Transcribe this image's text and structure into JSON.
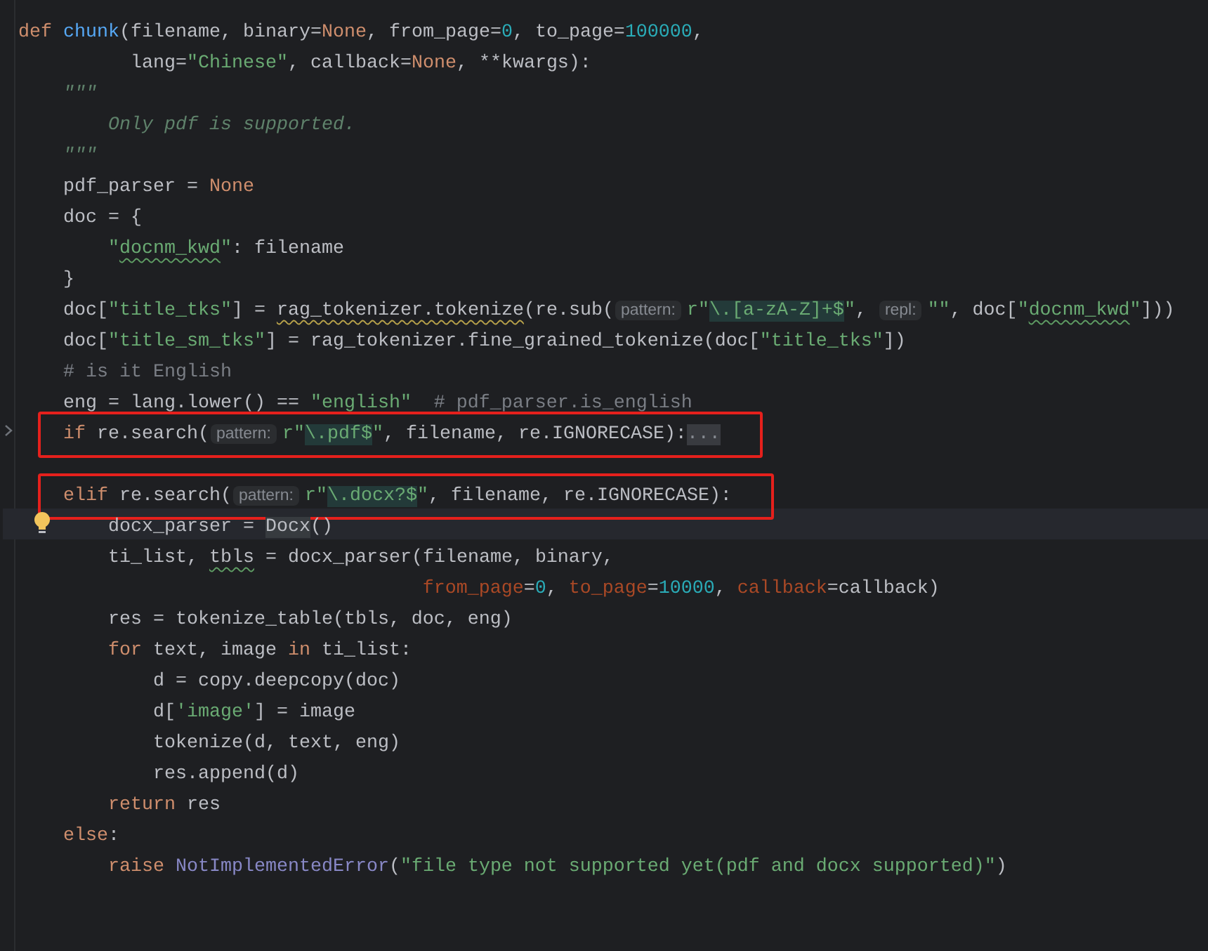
{
  "editor": {
    "lines": [
      {
        "boxed": false,
        "current": false,
        "tokens": [
          {
            "kind": "keyword",
            "text": "def "
          },
          {
            "kind": "function",
            "text": "chunk"
          },
          {
            "kind": "plain",
            "text": "(filename, binary="
          },
          {
            "kind": "keyword",
            "text": "None"
          },
          {
            "kind": "plain",
            "text": ", from_page="
          },
          {
            "kind": "number",
            "text": "0"
          },
          {
            "kind": "plain",
            "text": ", to_page="
          },
          {
            "kind": "number",
            "text": "100000"
          },
          {
            "kind": "plain",
            "text": ","
          }
        ]
      },
      {
        "boxed": false,
        "current": false,
        "tokens": [
          {
            "kind": "plain",
            "text": "          lang="
          },
          {
            "kind": "string",
            "text": "\"Chinese\""
          },
          {
            "kind": "plain",
            "text": ", callback="
          },
          {
            "kind": "keyword",
            "text": "None"
          },
          {
            "kind": "plain",
            "text": ", **kwargs):"
          }
        ]
      },
      {
        "boxed": false,
        "current": false,
        "tokens": [
          {
            "kind": "docstring",
            "text": "    \"\"\""
          }
        ]
      },
      {
        "boxed": false,
        "current": false,
        "tokens": [
          {
            "kind": "docstring",
            "text": "        Only pdf is supported."
          }
        ]
      },
      {
        "boxed": false,
        "current": false,
        "tokens": [
          {
            "kind": "docstring",
            "text": "    \"\"\""
          }
        ]
      },
      {
        "boxed": false,
        "current": false,
        "tokens": [
          {
            "kind": "plain",
            "text": "    pdf_parser = "
          },
          {
            "kind": "keyword",
            "text": "None"
          }
        ]
      },
      {
        "boxed": false,
        "current": false,
        "tokens": [
          {
            "kind": "plain",
            "text": "    doc = {"
          }
        ]
      },
      {
        "boxed": false,
        "current": false,
        "tokens": [
          {
            "kind": "string",
            "text": "        \""
          },
          {
            "kind": "misspelledstring",
            "text": "docnm_kwd"
          },
          {
            "kind": "string",
            "text": "\""
          },
          {
            "kind": "plain",
            "text": ": filename"
          }
        ]
      },
      {
        "boxed": false,
        "current": false,
        "tokens": [
          {
            "kind": "plain",
            "text": "    }"
          }
        ]
      },
      {
        "boxed": false,
        "current": false,
        "tokens": [
          {
            "kind": "plain",
            "text": "    doc["
          },
          {
            "kind": "string",
            "text": "\"title_tks\""
          },
          {
            "kind": "plain",
            "text": "] = "
          },
          {
            "kind": "warned",
            "text": "rag_tokenizer.tokenize"
          },
          {
            "kind": "plain",
            "text": "(re.sub("
          },
          {
            "kind": "hint",
            "text": "pattern:"
          },
          {
            "kind": "string",
            "text": "r\""
          },
          {
            "kind": "regex",
            "text": "\\.[a-zA-Z]+$"
          },
          {
            "kind": "string",
            "text": "\""
          },
          {
            "kind": "plain",
            "text": ", "
          },
          {
            "kind": "hint",
            "text": "repl:"
          },
          {
            "kind": "string",
            "text": "\"\""
          },
          {
            "kind": "plain",
            "text": ", doc["
          },
          {
            "kind": "string",
            "text": "\""
          },
          {
            "kind": "misspelledstring",
            "text": "docnm_kwd"
          },
          {
            "kind": "string",
            "text": "\""
          },
          {
            "kind": "plain",
            "text": "]))"
          }
        ]
      },
      {
        "boxed": false,
        "current": false,
        "tokens": [
          {
            "kind": "plain",
            "text": "    doc["
          },
          {
            "kind": "string",
            "text": "\"title_sm_tks\""
          },
          {
            "kind": "plain",
            "text": "] = rag_tokenizer.fine_grained_tokenize(doc["
          },
          {
            "kind": "string",
            "text": "\"title_tks\""
          },
          {
            "kind": "plain",
            "text": "])"
          }
        ]
      },
      {
        "boxed": false,
        "current": false,
        "tokens": [
          {
            "kind": "comment",
            "text": "    # is it English"
          }
        ]
      },
      {
        "boxed": false,
        "current": false,
        "tokens": [
          {
            "kind": "plain",
            "text": "    eng = lang.lower() == "
          },
          {
            "kind": "string",
            "text": "\"english\""
          },
          {
            "kind": "comment",
            "text": "  # pdf_parser.is_english"
          }
        ]
      },
      {
        "boxed": true,
        "current": false,
        "gutter": {
          "kind": "chevron"
        },
        "tokens": [
          {
            "kind": "keyword",
            "text": "    if"
          },
          {
            "kind": "plain",
            "text": " re.search("
          },
          {
            "kind": "hint",
            "text": "pattern:"
          },
          {
            "kind": "string",
            "text": "r\""
          },
          {
            "kind": "regex",
            "text": "\\.pdf$"
          },
          {
            "kind": "string",
            "text": "\""
          },
          {
            "kind": "plain",
            "text": ", filename, re.IGNORECASE):"
          },
          {
            "kind": "fold",
            "text": "..."
          }
        ]
      },
      {
        "boxed": false,
        "current": false
      },
      {
        "boxed": true,
        "current": false,
        "tokens": [
          {
            "kind": "keyword",
            "text": "    elif"
          },
          {
            "kind": "plain",
            "text": " re.search("
          },
          {
            "kind": "hint",
            "text": "pattern:"
          },
          {
            "kind": "string",
            "text": "r\""
          },
          {
            "kind": "regex",
            "text": "\\.docx?$"
          },
          {
            "kind": "string",
            "text": "\""
          },
          {
            "kind": "plain",
            "text": ", filename, re.IGNORECASE):"
          }
        ]
      },
      {
        "boxed": false,
        "current": true,
        "gutter": {
          "kind": "bulb"
        },
        "tokens": [
          {
            "kind": "plain",
            "text": "        docx_parser = "
          },
          {
            "kind": "marked",
            "text": "Docx"
          },
          {
            "kind": "plain",
            "text": "()"
          }
        ]
      },
      {
        "boxed": false,
        "current": false,
        "tokens": [
          {
            "kind": "plain",
            "text": "        ti_list, "
          },
          {
            "kind": "misspelled",
            "text": "tbls"
          },
          {
            "kind": "plain",
            "text": " = docx_parser(filename, binary,"
          }
        ]
      },
      {
        "boxed": false,
        "current": false,
        "tokens": [
          {
            "kind": "param",
            "text": "                                    from_page"
          },
          {
            "kind": "plain",
            "text": "="
          },
          {
            "kind": "number",
            "text": "0"
          },
          {
            "kind": "plain",
            "text": ", "
          },
          {
            "kind": "param",
            "text": "to_page"
          },
          {
            "kind": "plain",
            "text": "="
          },
          {
            "kind": "number",
            "text": "10000"
          },
          {
            "kind": "plain",
            "text": ", "
          },
          {
            "kind": "param",
            "text": "callback"
          },
          {
            "kind": "plain",
            "text": "=callback)"
          }
        ]
      },
      {
        "boxed": false,
        "current": false,
        "tokens": [
          {
            "kind": "plain",
            "text": "        res = tokenize_table(tbls, doc, eng)"
          }
        ]
      },
      {
        "boxed": false,
        "current": false,
        "tokens": [
          {
            "kind": "keyword",
            "text": "        for"
          },
          {
            "kind": "plain",
            "text": " text, image "
          },
          {
            "kind": "keyword",
            "text": "in"
          },
          {
            "kind": "plain",
            "text": " ti_list:"
          }
        ]
      },
      {
        "boxed": false,
        "current": false,
        "tokens": [
          {
            "kind": "plain",
            "text": "            d = copy.deepcopy(doc)"
          }
        ]
      },
      {
        "boxed": false,
        "current": false,
        "tokens": [
          {
            "kind": "plain",
            "text": "            d["
          },
          {
            "kind": "string",
            "text": "'image'"
          },
          {
            "kind": "plain",
            "text": "] = image"
          }
        ]
      },
      {
        "boxed": false,
        "current": false,
        "tokens": [
          {
            "kind": "plain",
            "text": "            tokenize(d, text, eng)"
          }
        ]
      },
      {
        "boxed": false,
        "current": false,
        "tokens": [
          {
            "kind": "plain",
            "text": "            res.append(d)"
          }
        ]
      },
      {
        "boxed": false,
        "current": false,
        "tokens": [
          {
            "kind": "keyword",
            "text": "        return"
          },
          {
            "kind": "plain",
            "text": " res"
          }
        ]
      },
      {
        "boxed": false,
        "current": false,
        "tokens": [
          {
            "kind": "keyword",
            "text": "    else"
          },
          {
            "kind": "plain",
            "text": ":"
          }
        ]
      },
      {
        "boxed": false,
        "current": false,
        "tokens": [
          {
            "kind": "keyword",
            "text": "        raise "
          },
          {
            "kind": "builtin",
            "text": "NotImplementedError"
          },
          {
            "kind": "plain",
            "text": "("
          },
          {
            "kind": "string",
            "text": "\"file type not supported yet(pdf and docx supported)\""
          },
          {
            "kind": "plain",
            "text": ")"
          }
        ]
      }
    ]
  }
}
